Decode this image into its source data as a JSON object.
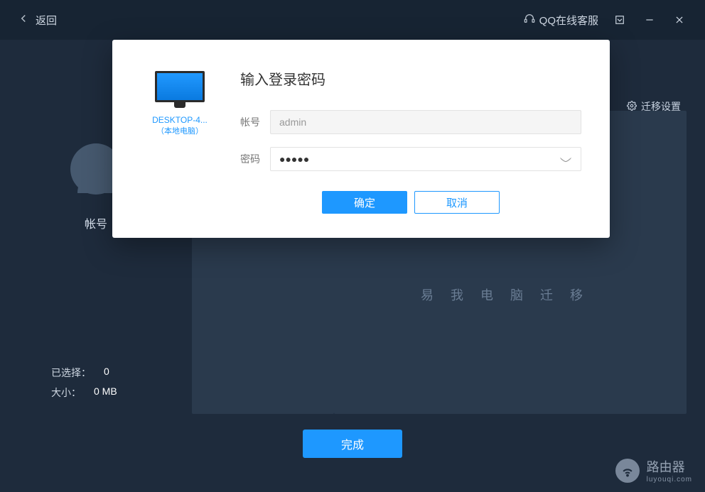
{
  "titlebar": {
    "back": "返回",
    "support": "QQ在线客服"
  },
  "main": {
    "migration_settings": "迁移设置",
    "account_label": "帐号",
    "selected_label": "已选择：",
    "selected_value": "0",
    "size_label": "大小：",
    "size_value": "0 MB",
    "content_text": "易我电脑迁移",
    "finish_btn": "完成"
  },
  "watermark": {
    "title": "路由器",
    "sub": "luyouqi.com"
  },
  "modal": {
    "title": "输入登录密码",
    "pc_name": "DESKTOP-4...",
    "pc_sub": "（本地电脑）",
    "account_label": "帐号",
    "account_value": "admin",
    "password_label": "密码",
    "password_masked": "●●●●●",
    "ok": "确定",
    "cancel": "取消"
  }
}
